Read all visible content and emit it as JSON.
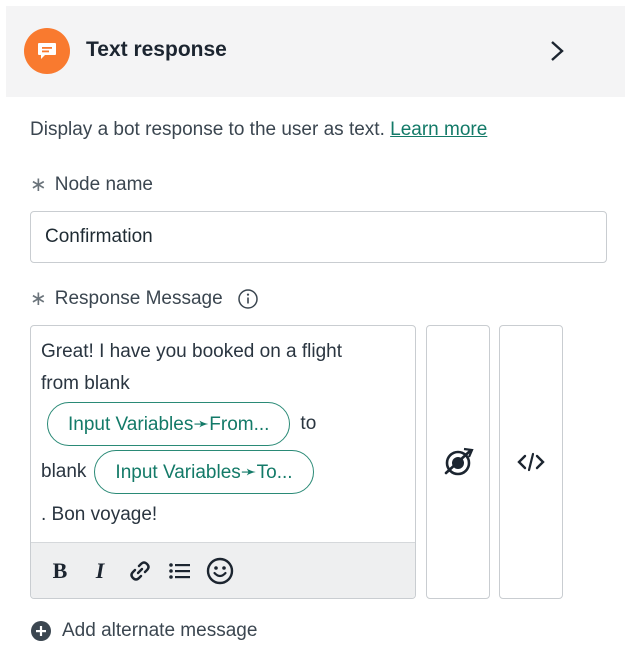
{
  "header": {
    "title": "Text response",
    "icon": "chat-bubble-icon",
    "icon_color": "#f97a2f"
  },
  "description": {
    "text": "Display a bot response to the user as text.",
    "link": "Learn more",
    "link_color": "#137a68"
  },
  "node_name": {
    "required_mark": "∗",
    "label": "Node name",
    "value": "Confirmation"
  },
  "response_message": {
    "required_mark": "∗",
    "label": "Response Message",
    "line1": "Great! I have you booked on a flight",
    "line2": "from blank",
    "chip_from": "Input Variables➛From...",
    "after_from": "to",
    "before_to": "blank",
    "chip_to": "Input Variables➛To...",
    "ending": ". Bon voyage!"
  },
  "toolbar": {
    "bold": "B",
    "italic": "I",
    "buttons": [
      "bold-icon",
      "italic-icon",
      "link-icon",
      "list-icon",
      "emoji-icon"
    ]
  },
  "side_buttons": [
    "variable-icon",
    "code-icon"
  ],
  "add_alternate": {
    "label": "Add alternate message"
  }
}
